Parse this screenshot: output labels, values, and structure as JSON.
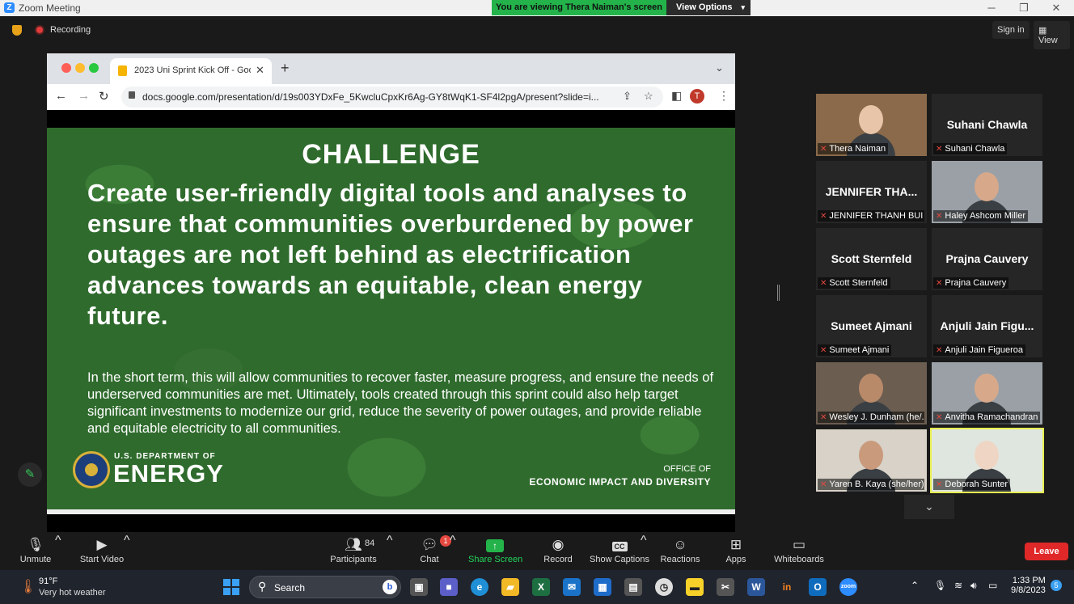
{
  "window": {
    "title": "Zoom Meeting",
    "viewing_banner": "You are viewing Thera Naiman's screen",
    "view_options": "View Options"
  },
  "meeting_top": {
    "recording_label": "Recording",
    "signin_label": "Sign in",
    "view_label": "View"
  },
  "browser": {
    "tab_title": "2023 Uni Sprint Kick Off - Goo",
    "url": "docs.google.com/presentation/d/19s003YDxFe_5KwcluCpxKr6Ag-GY8tWqK1-SF4l2pgA/present?slide=i...",
    "avatar_letter": "T"
  },
  "slide": {
    "heading": "CHALLENGE",
    "main_text": "Create user-friendly digital tools and analyses to ensure that communities overburdened by power outages are not left behind as electrification advances towards an equitable, clean energy future.",
    "sub_text": "In the short term, this will allow communities to recover faster, measure progress, and ensure the needs of underserved communities are met. Ultimately, tools created through this sprint could also help target significant investments to modernize our grid, reduce the severity of power outages, and provide reliable and equitable electricity to all communities.",
    "doe_dept": "U.S. DEPARTMENT OF",
    "doe_energy": "ENERGY",
    "office_line1": "OFFICE OF",
    "office_line2": "ECONOMIC IMPACT AND DIVERSITY"
  },
  "participants": [
    {
      "name": "",
      "label": "Thera Naiman",
      "video": true
    },
    {
      "name": "Suhani Chawla",
      "label": "Suhani Chawla",
      "video": false
    },
    {
      "name": "JENNIFER THA...",
      "label": "JENNIFER THANH BUI ...",
      "video": false
    },
    {
      "name": "",
      "label": "Haley Ashcom Miller",
      "video": true
    },
    {
      "name": "Scott Sternfeld",
      "label": "Scott Sternfeld",
      "video": false
    },
    {
      "name": "Prajna Cauvery",
      "label": "Prajna Cauvery",
      "video": false
    },
    {
      "name": "Sumeet Ajmani",
      "label": "Sumeet Ajmani",
      "video": false
    },
    {
      "name": "Anjuli Jain Figu...",
      "label": "Anjuli Jain Figueroa",
      "video": false
    },
    {
      "name": "",
      "label": "Wesley J. Dunham (he/...",
      "video": true
    },
    {
      "name": "",
      "label": "Anvitha Ramachandran",
      "video": true
    },
    {
      "name": "",
      "label": "Yaren B. Kaya (she/her)",
      "video": true
    },
    {
      "name": "",
      "label": "Deborah Sunter",
      "video": true,
      "active": true
    }
  ],
  "toolbar": {
    "unmute": "Unmute",
    "start_video": "Start Video",
    "participants": "Participants",
    "participants_count": "84",
    "chat": "Chat",
    "chat_badge": "1",
    "share_screen": "Share Screen",
    "record": "Record",
    "show_captions": "Show Captions",
    "captions_icon": "CC",
    "reactions": "Reactions",
    "apps": "Apps",
    "whiteboards": "Whiteboards",
    "leave": "Leave"
  },
  "taskbar": {
    "temperature": "91°F",
    "weather": "Very hot weather",
    "search_placeholder": "Search",
    "time": "1:33 PM",
    "date": "9/8/2023",
    "notification_count": "5"
  },
  "colors": {
    "zoom_green": "#23b34a",
    "leave_red": "#e02828",
    "slide_green": "#2f6b2d",
    "active_speaker": "#e7f04f"
  }
}
